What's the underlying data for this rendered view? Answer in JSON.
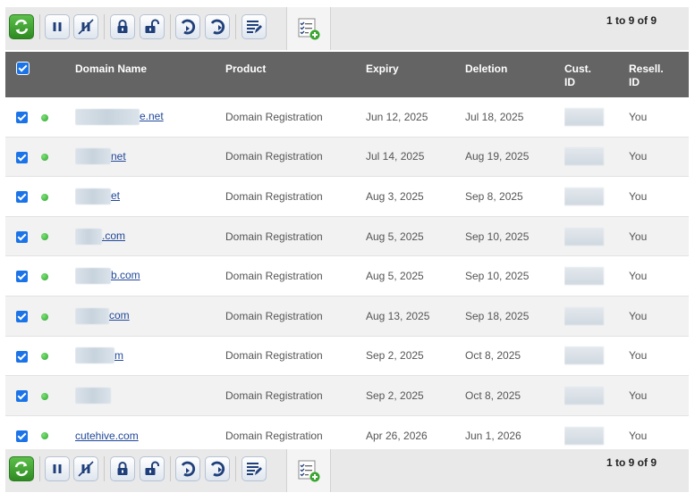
{
  "toolbar": {
    "buttons": [
      "refresh-button",
      "pause-button",
      "unpause-button",
      "lock-button",
      "unlock-button",
      "suspend-button",
      "unsuspend-button",
      "edit-button"
    ],
    "add_button": "add-list-button",
    "pager_text": "1 to 9 of 9"
  },
  "colors": {
    "header_bg": "#646464",
    "link": "#21489a",
    "expiry_warning": "#c00000",
    "active_dot": "#2aa52a"
  },
  "table": {
    "columns": [
      "Domain Name",
      "Product",
      "Expiry",
      "Deletion",
      "Cust.\nID",
      "Resell.\nID"
    ],
    "rows": [
      {
        "domain": "e.net",
        "product": "Domain Registration",
        "expiry": "Jun 12, 2025",
        "deletion": "Jul 18, 2025",
        "reseller": "You",
        "warn": true
      },
      {
        "domain": "net",
        "product": "Domain Registration",
        "expiry": "Jul 14, 2025",
        "deletion": "Aug 19, 2025",
        "reseller": "You",
        "warn": false
      },
      {
        "domain": "et",
        "product": "Domain Registration",
        "expiry": "Aug 3, 2025",
        "deletion": "Sep 8, 2025",
        "reseller": "You",
        "warn": false
      },
      {
        "domain": ".com",
        "product": "Domain Registration",
        "expiry": "Aug 5, 2025",
        "deletion": "Sep 10, 2025",
        "reseller": "You",
        "warn": false
      },
      {
        "domain": "b.com",
        "product": "Domain Registration",
        "expiry": "Aug 5, 2025",
        "deletion": "Sep 10, 2025",
        "reseller": "You",
        "warn": false
      },
      {
        "domain": "com",
        "product": "Domain Registration",
        "expiry": "Aug 13, 2025",
        "deletion": "Sep 18, 2025",
        "reseller": "You",
        "warn": false
      },
      {
        "domain": "m",
        "product": "Domain Registration",
        "expiry": "Sep 2, 2025",
        "deletion": "Oct 8, 2025",
        "reseller": "You",
        "warn": false
      },
      {
        "domain": "",
        "product": "Domain Registration",
        "expiry": "Sep 2, 2025",
        "deletion": "Oct 8, 2025",
        "reseller": "You",
        "warn": false
      },
      {
        "domain": "cutehive.com",
        "product": "Domain Registration",
        "expiry": "Apr 26, 2026",
        "deletion": "Jun 1, 2026",
        "reseller": "You",
        "warn": false
      }
    ]
  }
}
